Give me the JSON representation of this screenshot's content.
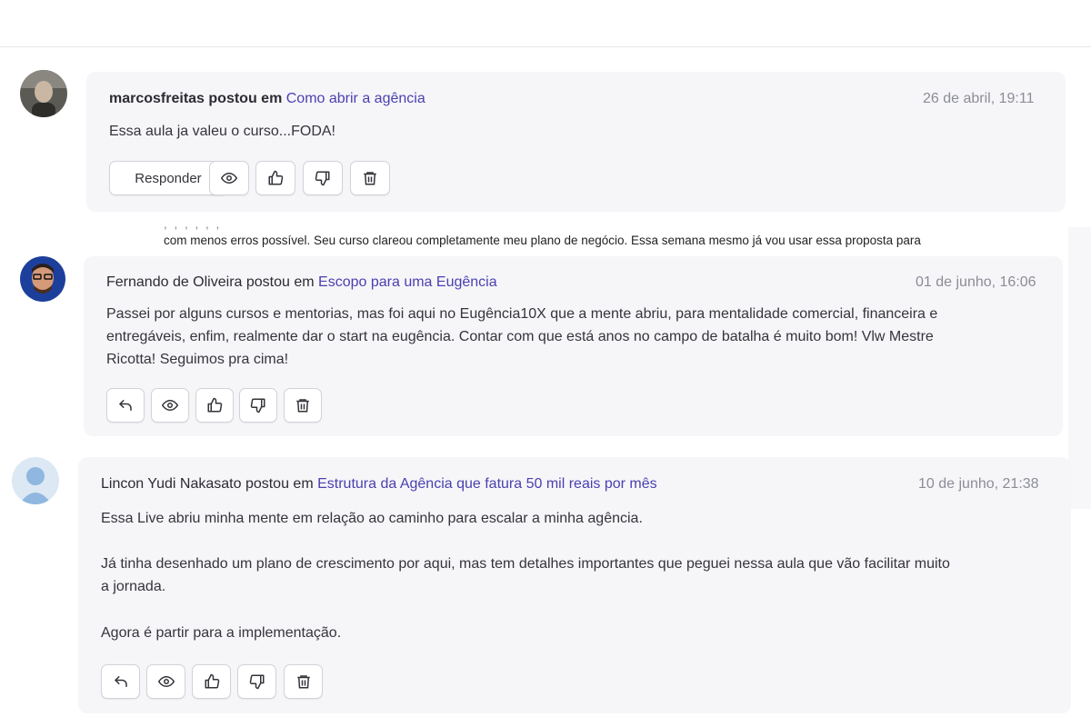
{
  "comments": [
    {
      "author": "marcosfreitas",
      "connector": "postou em",
      "lesson": "Como abrir a agência",
      "date": "26 de abril, 19:11",
      "text": [
        "Essa aula ja valeu o curso...FODA!"
      ],
      "reply_label": "Responder"
    },
    {
      "author": "Fernando de Oliveira",
      "connector": "postou em",
      "lesson": "Escopo para uma Eugência",
      "date": "01 de junho, 16:06",
      "text": [
        "Passei por alguns cursos e mentorias, mas foi aqui no Eugência10X que a mente abriu, para mentalidade comercial, financeira e",
        "entregáveis, enfim, realmente dar o start na eugência. Contar com que está anos no campo de batalha é muito bom! Vlw Mestre",
        "Ricotta! Seguimos pra cima!"
      ]
    },
    {
      "author": "Lincon Yudi Nakasato",
      "connector": "postou em",
      "lesson": "Estrutura da Agência que fatura 50 mil reais por mês",
      "date": "10 de junho, 21:38",
      "text": [
        "Essa Live abriu minha mente em relação ao caminho para escalar a minha agência.",
        "Já tinha desenhado um plano de crescimento por aqui, mas tem detalhes importantes que peguei nessa aula que vão facilitar muito",
        "a jornada.",
        "Agora é partir para a implementação."
      ]
    }
  ],
  "overlap_fragment": "com menos erros possível. Seu curso clareou completamente meu plano de negócio. Essa semana mesmo já vou usar essa proposta para",
  "icons": [
    "reply-icon",
    "eye-icon",
    "thumbs-up-icon",
    "thumbs-down-icon",
    "trash-icon"
  ],
  "colors": {
    "link": "#4a3fb0",
    "card_bg": "#f6f6f9",
    "date": "#8c8c96"
  }
}
